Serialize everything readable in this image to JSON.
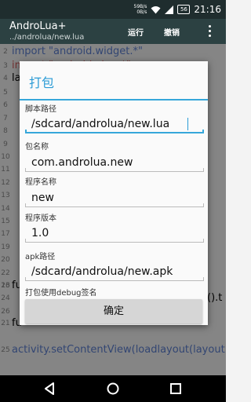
{
  "status_bar": {
    "net_down": "59B/s",
    "net_up": "0B/s",
    "battery": "56",
    "time": "21:16"
  },
  "app_bar": {
    "title": "AndroLua+",
    "subtitle": "../androlua/new.lua",
    "run_label": "运行",
    "undo_label": "撤销"
  },
  "editor": {
    "lines": [
      {
        "num": "2",
        "text": "import \"android.widget.*\"",
        "color": "#5b7fd0"
      },
      {
        "num": "3",
        "text": "import \"android.view.*\"",
        "color": "#d05b5b"
      },
      {
        "num": "4",
        "text": "la",
        "color": "#222222"
      },
      {
        "num": "16",
        "text": "fu",
        "color": "#222222"
      },
      {
        "num": "18",
        "text": "().t",
        "color": "#222222"
      },
      {
        "num": "21",
        "text": "fu",
        "color": "#222222"
      },
      {
        "num": "25",
        "text": "activity.setContentView(loadlayout(layout",
        "color": "#5b7fd0"
      }
    ],
    "extra_numbers": [
      "5",
      "6",
      "7",
      "8",
      "9",
      "10",
      "11",
      "12",
      "13",
      "14",
      "15",
      "17",
      "19",
      "20",
      "22",
      "23",
      "24",
      "26"
    ]
  },
  "dialog": {
    "title": "打包",
    "fields": [
      {
        "label": "脚本路径",
        "value": "/sdcard/androlua/new.lua"
      },
      {
        "label": "包名称",
        "value": "com.androlua.new"
      },
      {
        "label": "程序名称",
        "value": "new"
      },
      {
        "label": "程序版本",
        "value": "1.0"
      },
      {
        "label": "apk路径",
        "value": "/sdcard/androlua/new.apk"
      }
    ],
    "debug_sign_label": "打包使用debug签名",
    "confirm_label": "确定"
  },
  "colors": {
    "accent": "#36a7da",
    "app_bar": "#2c4142",
    "status_bar": "#1f2d2e"
  }
}
